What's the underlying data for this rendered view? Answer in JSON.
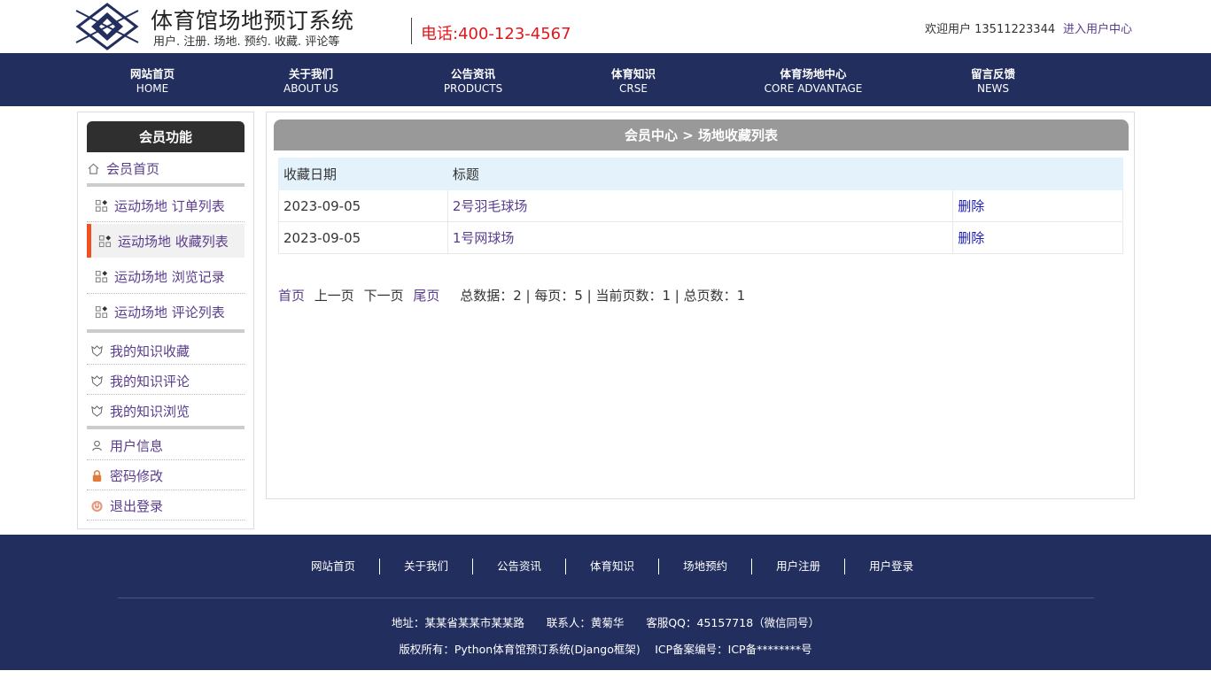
{
  "header": {
    "site_title": "体育馆场地预订系统",
    "site_subtitle": "用户. 注册. 场地. 预约. 收藏. 评论等",
    "phone": "电话:400-123-4567",
    "welcome": "欢迎用户 13511223344",
    "user_center_link": "进入用户中心"
  },
  "nav": {
    "items": [
      {
        "label": "网站首页",
        "sub": "HOME"
      },
      {
        "label": "关于我们",
        "sub": "ABOUT US"
      },
      {
        "label": "公告资讯",
        "sub": "PRODUCTS"
      },
      {
        "label": "体育知识",
        "sub": "CRSE"
      },
      {
        "label": "体育场地中心",
        "sub": "CORE ADVANTAGE"
      },
      {
        "label": "留言反馈",
        "sub": "NEWS"
      }
    ]
  },
  "sidebar": {
    "title": "会员功能",
    "items": [
      {
        "label": "会员首页",
        "icon": "home-icon"
      },
      {
        "label": "运动场地 订单列表",
        "icon": "grid-icon"
      },
      {
        "label": "运动场地 收藏列表",
        "icon": "grid-icon",
        "active": true
      },
      {
        "label": "运动场地 浏览记录",
        "icon": "grid-icon"
      },
      {
        "label": "运动场地 评论列表",
        "icon": "grid-icon"
      },
      {
        "label": "我的知识收藏",
        "icon": "shield-icon"
      },
      {
        "label": "我的知识评论",
        "icon": "shield-icon"
      },
      {
        "label": "我的知识浏览",
        "icon": "shield-icon"
      },
      {
        "label": "用户信息",
        "icon": "user-icon"
      },
      {
        "label": "密码修改",
        "icon": "lock-icon"
      },
      {
        "label": "退出登录",
        "icon": "power-icon"
      }
    ]
  },
  "main": {
    "breadcrumb": "会员中心 > 场地收藏列表",
    "columns": [
      "收藏日期",
      "标题",
      ""
    ],
    "rows": [
      {
        "date": "2023-09-05",
        "title": "2号羽毛球场",
        "action": "删除"
      },
      {
        "date": "2023-09-05",
        "title": "1号网球场",
        "action": "删除"
      }
    ],
    "pager": {
      "first": "首页",
      "prev": "上一页",
      "next": "下一页",
      "last": "尾页",
      "summary": "总数据：2 | 每页：5 | 当前页数：1 | 总页数：1"
    }
  },
  "footer": {
    "links": [
      "网站首页",
      "关于我们",
      "公告资讯",
      "体育知识",
      "场地预约",
      "用户注册",
      "用户登录"
    ],
    "address_line": "地址：某某省某某市某某路　　联系人：黄菊华　　客服QQ：45157718（微信同号）",
    "copyright_line": "版权所有：Python体育馆预订系统(Django框架)　 ICP备案编号：ICP备********号"
  },
  "colors": {
    "nav_bg": "#222e5e",
    "phone": "#e4161c",
    "link": "#5a3c8c",
    "active_marker": "#f25022"
  }
}
